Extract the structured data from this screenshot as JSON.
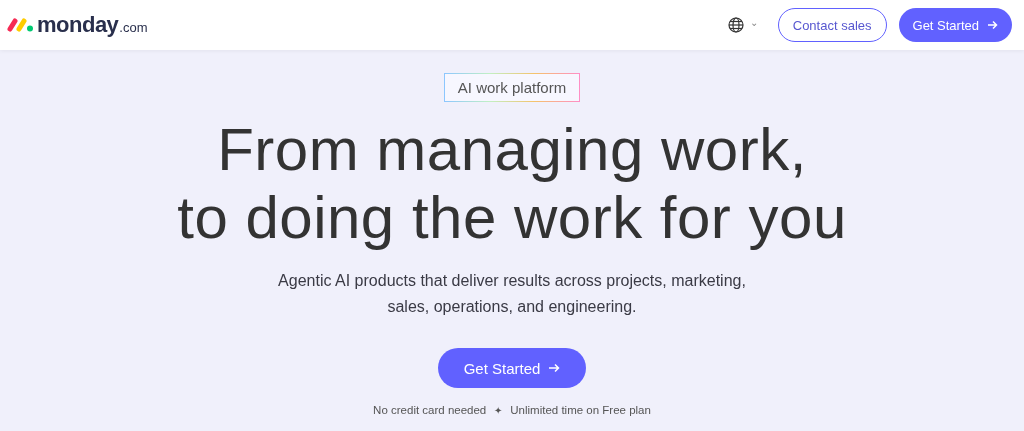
{
  "header": {
    "logo": {
      "name": "monday",
      "suffix": ".com"
    },
    "language_caret": "⌄",
    "contact_button": "Contact sales",
    "cta_button": "Get Started"
  },
  "hero": {
    "badge": "AI work platform",
    "headline": [
      "From managing work,",
      "to doing the work for you"
    ],
    "subtitle": [
      "Agentic AI products that deliver results across projects, marketing,",
      "sales, operations, and engineering."
    ],
    "cta_button": "Get Started",
    "notes": [
      "No credit card needed",
      "✦",
      "Unlimited time on Free plan"
    ]
  }
}
